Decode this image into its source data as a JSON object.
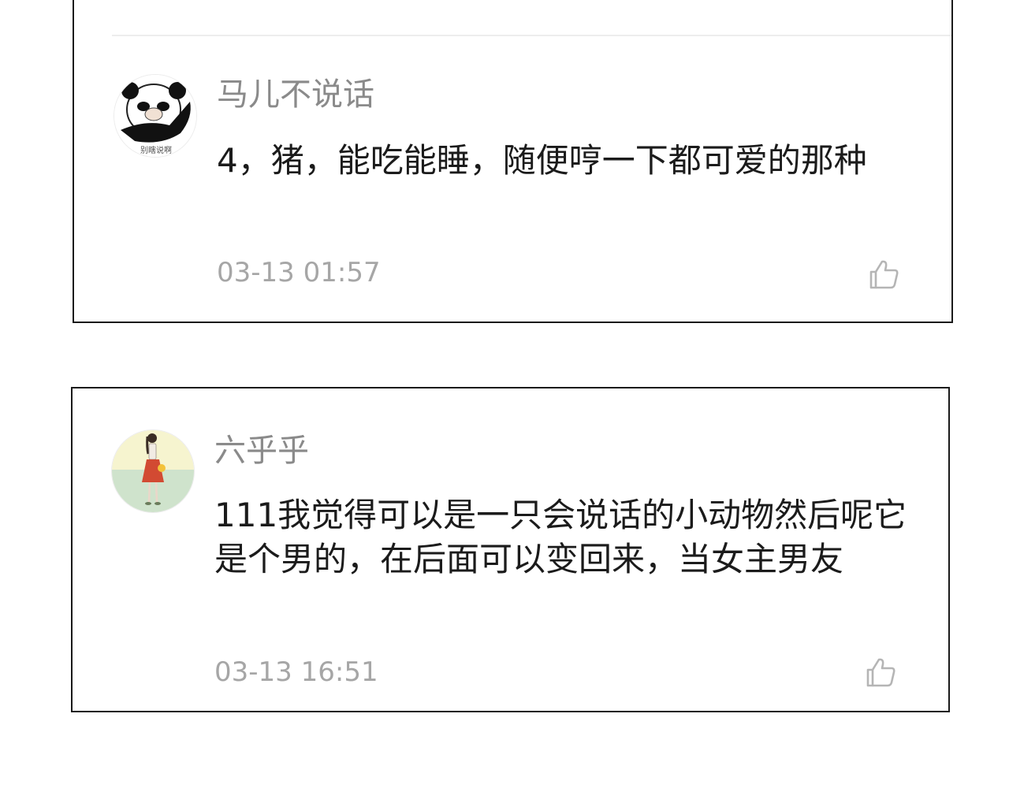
{
  "comments": [
    {
      "username": "马儿不说话",
      "avatar": "panda-meme-avatar",
      "text": "4，猪，能吃能睡，随便哼一下都可爱的那种",
      "timestamp": "03-13 01:57",
      "like_icon": "thumbs-up-icon"
    },
    {
      "username": "六乎乎",
      "avatar": "girl-red-skirt-avatar",
      "text": "111我觉得可以是一只会说话的小动物然后呢它是个男的，在后面可以变回来，当女主男友",
      "timestamp": "03-13 16:51",
      "like_icon": "thumbs-up-icon"
    }
  ],
  "colors": {
    "card_border": "#1a1a1a",
    "username": "#8a8a8a",
    "comment_text": "#1b1b1b",
    "timestamp": "#a6a6a6",
    "icon": "#b5b5b5",
    "avatar2_top": "#f6f4cf",
    "avatar2_bottom": "#cfe3cc"
  }
}
